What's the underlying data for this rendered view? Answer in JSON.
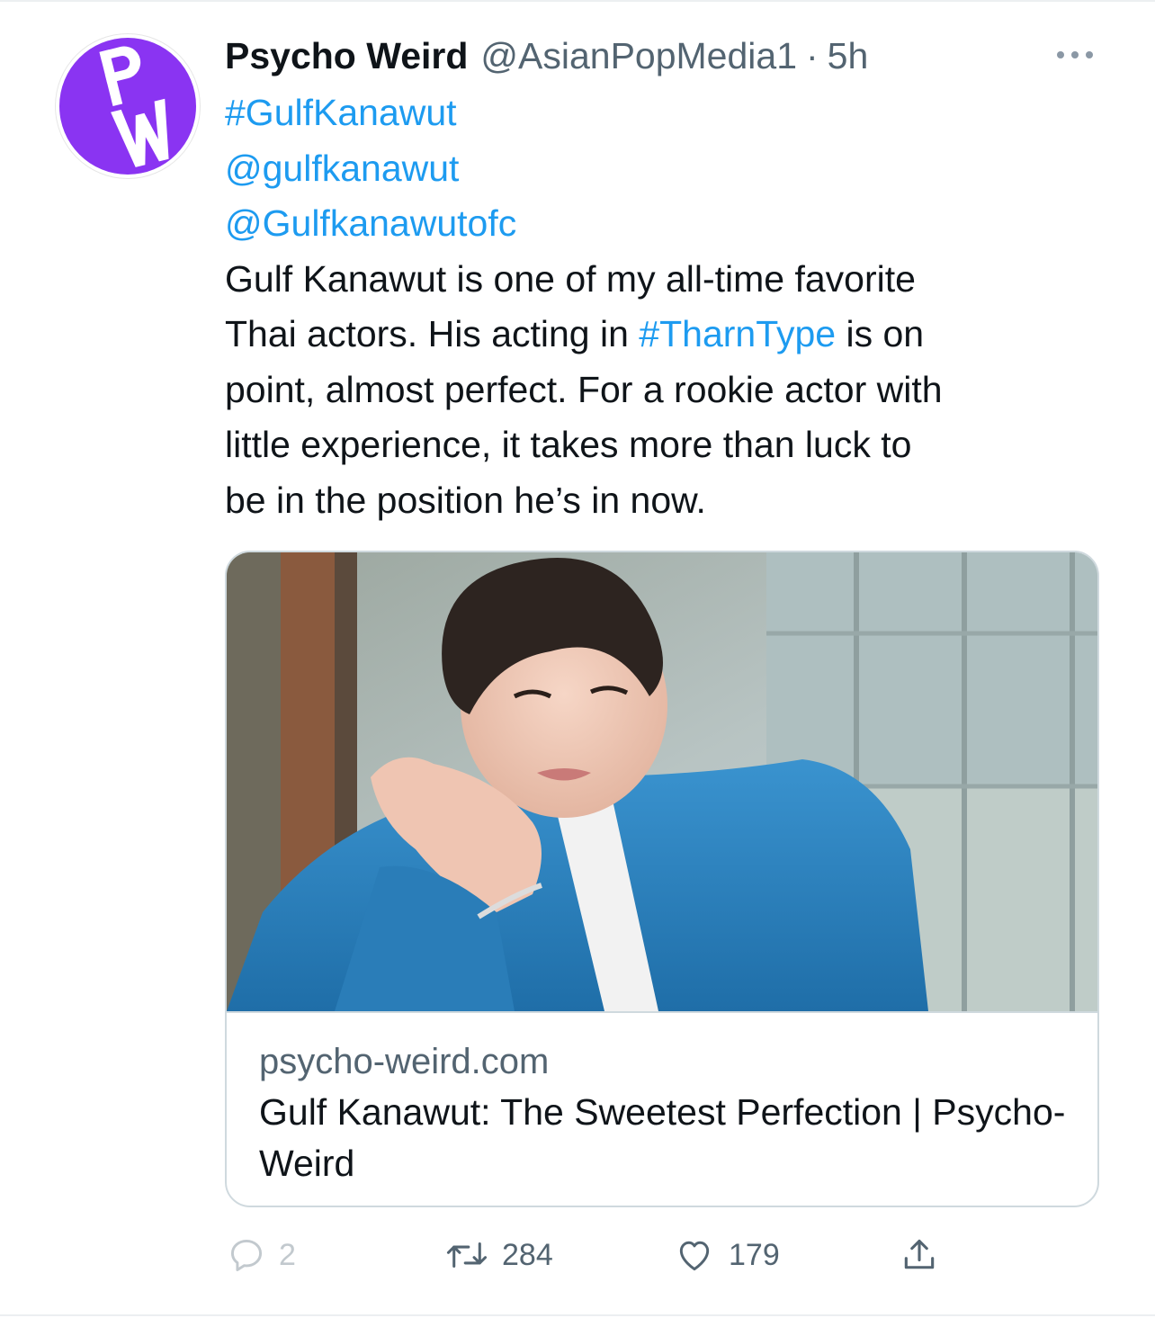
{
  "tweet": {
    "avatar_letters": "PW",
    "display_name": "Psycho Weird",
    "handle": "@AsianPopMedia1",
    "separator": "·",
    "time": "5h",
    "more_icon": "more-horizontal-icon",
    "hashtag": "#GulfKanawut",
    "mention_1": "@gulfkanawut",
    "mention_2": "@Gulfkanawutofc",
    "text_line_1": "Gulf Kanawut is one of my all-time favorite",
    "text_line_2_before": "Thai actors. His acting in ",
    "text_line_2_link": "#TharnType",
    "text_line_2_after": " is on",
    "text_line_3": "point, almost perfect. For a rookie actor with",
    "text_line_4": "little experience, it takes more than luck to",
    "text_line_5": "be in the position he’s in now."
  },
  "card": {
    "domain": "psycho-weird.com",
    "title": "Gulf Kanawut: The Sweetest Perfection | Psycho-Weird"
  },
  "actions": {
    "reply_count": "2",
    "retweet_count": "284",
    "like_count": "179"
  },
  "colors": {
    "link": "#1d9bf0",
    "secondary_text": "#536471",
    "avatar_purple": "#8a34f2",
    "jacket_blue": "#2f86c2"
  }
}
